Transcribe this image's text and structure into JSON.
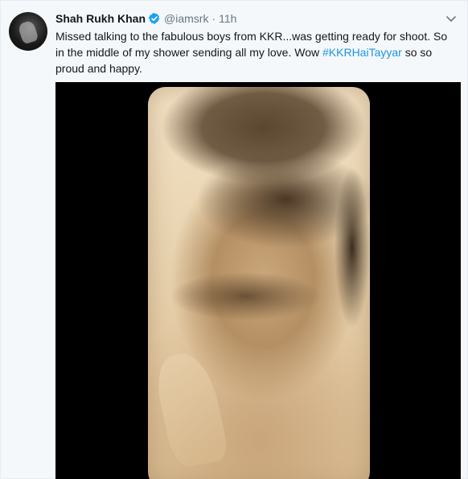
{
  "tweet": {
    "author_name": "Shah Rukh Khan",
    "handle": "@iamsrk",
    "separator": "·",
    "time": "11h",
    "text_before": "Missed talking to the fabulous boys from KKR...was getting ready for shoot. So in the middle of my shower sending  all my love. Wow ",
    "hashtag": "#KKRHaiTayyar",
    "text_after": " so so proud and happy."
  },
  "icons": {
    "verified": "verified-badge-icon",
    "caret": "chevron-down-icon"
  },
  "colors": {
    "link": "#1b95e0",
    "verified": "#1da1f2",
    "text": "#14171a",
    "muted": "#657786",
    "background": "#f5f8fa",
    "media_background": "#000000"
  }
}
